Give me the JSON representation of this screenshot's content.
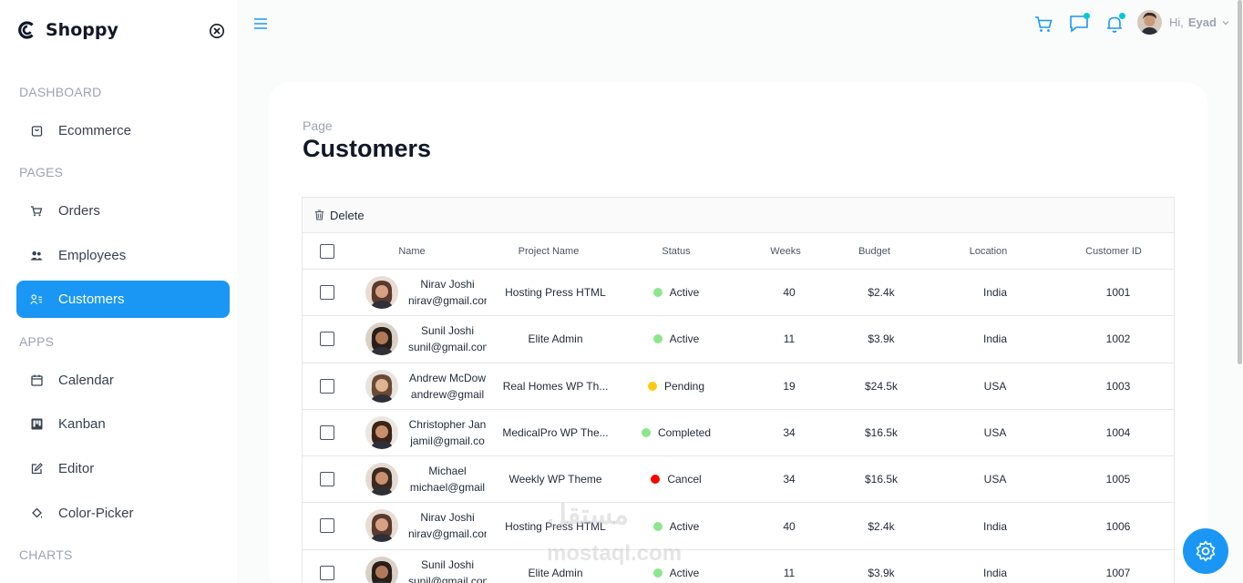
{
  "app": {
    "name": "Shoppy"
  },
  "sidebar": {
    "sections": [
      {
        "title": "DASHBOARD",
        "items": [
          {
            "label": "Ecommerce",
            "icon": "bag-icon"
          }
        ]
      },
      {
        "title": "PAGES",
        "items": [
          {
            "label": "Orders",
            "icon": "cart-icon"
          },
          {
            "label": "Employees",
            "icon": "people-icon"
          },
          {
            "label": "Customers",
            "icon": "contacts-icon",
            "active": true
          }
        ]
      },
      {
        "title": "APPS",
        "items": [
          {
            "label": "Calendar",
            "icon": "calendar-icon"
          },
          {
            "label": "Kanban",
            "icon": "kanban-icon"
          },
          {
            "label": "Editor",
            "icon": "edit-icon"
          },
          {
            "label": "Color-Picker",
            "icon": "color-picker-icon"
          }
        ]
      },
      {
        "title": "CHARTS",
        "items": []
      }
    ]
  },
  "topbar": {
    "greeting": "Hi,",
    "username": "Eyad"
  },
  "page": {
    "label": "Page",
    "title": "Customers"
  },
  "grid": {
    "delete_label": "Delete",
    "columns": [
      "Name",
      "Project Name",
      "Status",
      "Weeks",
      "Budget",
      "Location",
      "Customer ID"
    ],
    "rows": [
      {
        "name": "Nirav Joshi",
        "email": "nirav@gmail.com",
        "project": "Hosting Press HTML",
        "status": "Active",
        "status_color": "#8be78b",
        "weeks": "40",
        "budget": "$2.4k",
        "location": "India",
        "id": "1001"
      },
      {
        "name": "Sunil Joshi",
        "email": "sunil@gmail.com",
        "project": "Elite Admin",
        "status": "Active",
        "status_color": "#8be78b",
        "weeks": "11",
        "budget": "$3.9k",
        "location": "India",
        "id": "1002"
      },
      {
        "name": "Andrew McDow",
        "email": "andrew@gmail",
        "project": "Real Homes WP Th...",
        "status": "Pending",
        "status_color": "#fec90f",
        "weeks": "19",
        "budget": "$24.5k",
        "location": "USA",
        "id": "1003"
      },
      {
        "name": "Christopher Jan",
        "email": "jamil@gmail.co",
        "project": "MedicalPro WP The...",
        "status": "Completed",
        "status_color": "#8be78b",
        "weeks": "34",
        "budget": "$16.5k",
        "location": "USA",
        "id": "1004"
      },
      {
        "name": "Michael",
        "email": "michael@gmail",
        "project": "Weekly WP Theme",
        "status": "Cancel",
        "status_color": "#ff0000",
        "weeks": "34",
        "budget": "$16.5k",
        "location": "USA",
        "id": "1005"
      },
      {
        "name": "Nirav Joshi",
        "email": "nirav@gmail.com",
        "project": "Hosting Press HTML",
        "status": "Active",
        "status_color": "#8be78b",
        "weeks": "40",
        "budget": "$2.4k",
        "location": "India",
        "id": "1006"
      },
      {
        "name": "Sunil Joshi",
        "email": "sunil@gmail.com",
        "project": "Elite Admin",
        "status": "Active",
        "status_color": "#8be78b",
        "weeks": "11",
        "budget": "$3.9k",
        "location": "India",
        "id": "1007"
      }
    ]
  },
  "watermark": {
    "arabic": "مستقل",
    "latin": "mostaql.com"
  },
  "colors": {
    "accent": "#1a97f5",
    "notification_dot": "#03c9d7"
  }
}
